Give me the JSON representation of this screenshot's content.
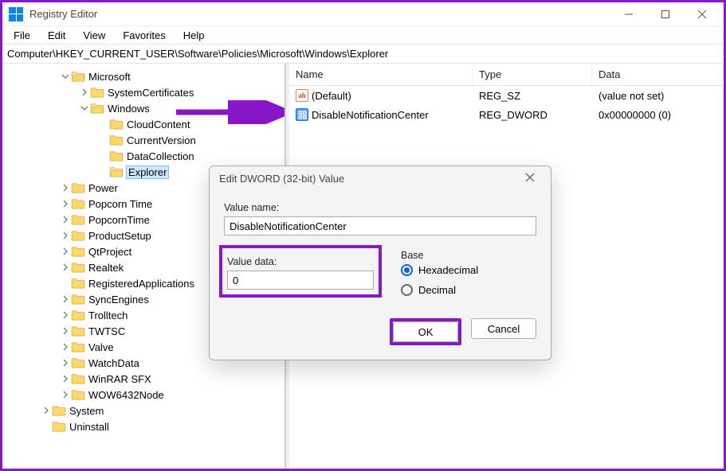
{
  "window": {
    "title": "Registry Editor"
  },
  "menu": [
    "File",
    "Edit",
    "View",
    "Favorites",
    "Help"
  ],
  "path": "Computer\\HKEY_CURRENT_USER\\Software\\Policies\\Microsoft\\Windows\\Explorer",
  "tree": {
    "microsoft": "Microsoft",
    "systemcerts": "SystemCertificates",
    "windows": "Windows",
    "cloudcontent": "CloudContent",
    "currentversion": "CurrentVersion",
    "datacollection": "DataCollection",
    "explorer": "Explorer",
    "power": "Power",
    "popcorn_time": "Popcorn Time",
    "popcorntime": "PopcornTime",
    "productsetup": "ProductSetup",
    "qtproject": "QtProject",
    "realtek": "Realtek",
    "registeredapps": "RegisteredApplications",
    "syncengines": "SyncEngines",
    "trolltech": "Trolltech",
    "twtsc": "TWTSC",
    "valve": "Valve",
    "watchdata": "WatchData",
    "winrarsfx": "WinRAR SFX",
    "wow6432": "WOW6432Node",
    "system": "System",
    "uninstall": "Uninstall"
  },
  "columns": {
    "name": "Name",
    "type": "Type",
    "data": "Data"
  },
  "rows": [
    {
      "icon": "ab",
      "name": "(Default)",
      "type": "REG_SZ",
      "data": "(value not set)"
    },
    {
      "icon": "dw",
      "name": "DisableNotificationCenter",
      "type": "REG_DWORD",
      "data": "0x00000000 (0)"
    }
  ],
  "dialog": {
    "title": "Edit DWORD (32-bit) Value",
    "valuename_label": "Value name:",
    "valuename": "DisableNotificationCenter",
    "valuedata_label": "Value data:",
    "valuedata": "0",
    "base_label": "Base",
    "hex": "Hexadecimal",
    "dec": "Decimal",
    "ok": "OK",
    "cancel": "Cancel"
  }
}
